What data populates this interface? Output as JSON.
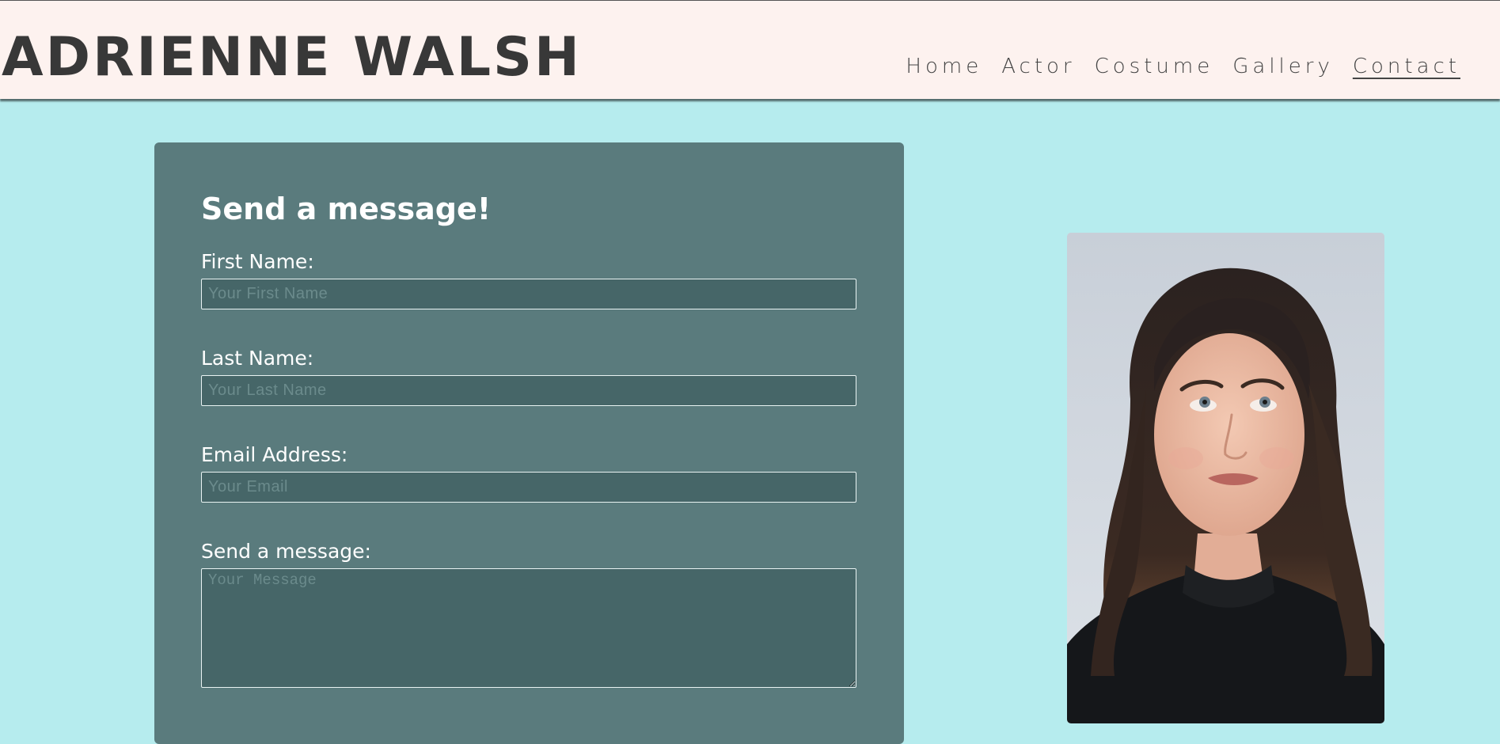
{
  "header": {
    "site_title": "ADRIENNE WALSH",
    "nav": [
      {
        "label": "Home",
        "active": false
      },
      {
        "label": "Actor",
        "active": false
      },
      {
        "label": "Costume",
        "active": false
      },
      {
        "label": "Gallery",
        "active": false
      },
      {
        "label": "Contact",
        "active": true
      }
    ]
  },
  "form": {
    "heading": "Send a message!",
    "first_name": {
      "label": "First Name:",
      "placeholder": "Your First Name",
      "value": ""
    },
    "last_name": {
      "label": "Last Name:",
      "placeholder": "Your Last Name",
      "value": ""
    },
    "email": {
      "label": "Email Address:",
      "placeholder": "Your Email",
      "value": ""
    },
    "message": {
      "label": "Send a message:",
      "placeholder": "Your Message",
      "value": ""
    }
  },
  "colors": {
    "page_background": "#b6ecee",
    "header_background": "#fdf2ef",
    "form_background": "#5a7b7d",
    "input_background": "#466668"
  }
}
